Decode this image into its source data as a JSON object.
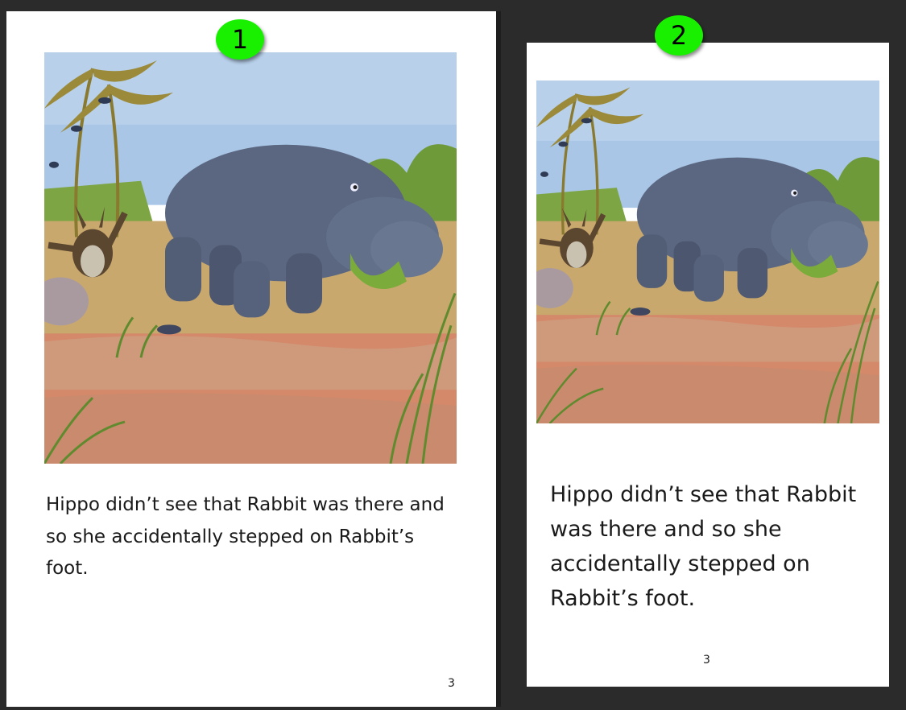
{
  "versions": [
    {
      "badge": "1",
      "illustration": "hippo-stepping-on-rabbit-foot",
      "text": "Hippo didn’t see that Rabbit was there and so she accidentally stepped on Rabbit’s foot.",
      "page_number": "3"
    },
    {
      "badge": "2",
      "illustration": "hippo-stepping-on-rabbit-foot",
      "text": "Hippo didn’t see that Rabbit was there and so she accidentally stepped on Rabbit’s foot.",
      "page_number": "3"
    }
  ],
  "colors": {
    "background": "#2b2b2b",
    "page": "#ffffff",
    "badge": "#19f000",
    "text": "#1a1a1a"
  }
}
